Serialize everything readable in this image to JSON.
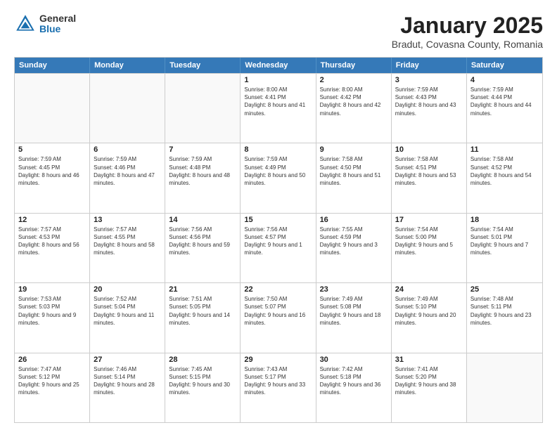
{
  "header": {
    "logo_general": "General",
    "logo_blue": "Blue",
    "main_title": "January 2025",
    "subtitle": "Bradut, Covasna County, Romania"
  },
  "days_of_week": [
    "Sunday",
    "Monday",
    "Tuesday",
    "Wednesday",
    "Thursday",
    "Friday",
    "Saturday"
  ],
  "weeks": [
    [
      {
        "day": "",
        "info": ""
      },
      {
        "day": "",
        "info": ""
      },
      {
        "day": "",
        "info": ""
      },
      {
        "day": "1",
        "info": "Sunrise: 8:00 AM\nSunset: 4:41 PM\nDaylight: 8 hours and 41 minutes."
      },
      {
        "day": "2",
        "info": "Sunrise: 8:00 AM\nSunset: 4:42 PM\nDaylight: 8 hours and 42 minutes."
      },
      {
        "day": "3",
        "info": "Sunrise: 7:59 AM\nSunset: 4:43 PM\nDaylight: 8 hours and 43 minutes."
      },
      {
        "day": "4",
        "info": "Sunrise: 7:59 AM\nSunset: 4:44 PM\nDaylight: 8 hours and 44 minutes."
      }
    ],
    [
      {
        "day": "5",
        "info": "Sunrise: 7:59 AM\nSunset: 4:45 PM\nDaylight: 8 hours and 46 minutes."
      },
      {
        "day": "6",
        "info": "Sunrise: 7:59 AM\nSunset: 4:46 PM\nDaylight: 8 hours and 47 minutes."
      },
      {
        "day": "7",
        "info": "Sunrise: 7:59 AM\nSunset: 4:48 PM\nDaylight: 8 hours and 48 minutes."
      },
      {
        "day": "8",
        "info": "Sunrise: 7:59 AM\nSunset: 4:49 PM\nDaylight: 8 hours and 50 minutes."
      },
      {
        "day": "9",
        "info": "Sunrise: 7:58 AM\nSunset: 4:50 PM\nDaylight: 8 hours and 51 minutes."
      },
      {
        "day": "10",
        "info": "Sunrise: 7:58 AM\nSunset: 4:51 PM\nDaylight: 8 hours and 53 minutes."
      },
      {
        "day": "11",
        "info": "Sunrise: 7:58 AM\nSunset: 4:52 PM\nDaylight: 8 hours and 54 minutes."
      }
    ],
    [
      {
        "day": "12",
        "info": "Sunrise: 7:57 AM\nSunset: 4:53 PM\nDaylight: 8 hours and 56 minutes."
      },
      {
        "day": "13",
        "info": "Sunrise: 7:57 AM\nSunset: 4:55 PM\nDaylight: 8 hours and 58 minutes."
      },
      {
        "day": "14",
        "info": "Sunrise: 7:56 AM\nSunset: 4:56 PM\nDaylight: 8 hours and 59 minutes."
      },
      {
        "day": "15",
        "info": "Sunrise: 7:56 AM\nSunset: 4:57 PM\nDaylight: 9 hours and 1 minute."
      },
      {
        "day": "16",
        "info": "Sunrise: 7:55 AM\nSunset: 4:59 PM\nDaylight: 9 hours and 3 minutes."
      },
      {
        "day": "17",
        "info": "Sunrise: 7:54 AM\nSunset: 5:00 PM\nDaylight: 9 hours and 5 minutes."
      },
      {
        "day": "18",
        "info": "Sunrise: 7:54 AM\nSunset: 5:01 PM\nDaylight: 9 hours and 7 minutes."
      }
    ],
    [
      {
        "day": "19",
        "info": "Sunrise: 7:53 AM\nSunset: 5:03 PM\nDaylight: 9 hours and 9 minutes."
      },
      {
        "day": "20",
        "info": "Sunrise: 7:52 AM\nSunset: 5:04 PM\nDaylight: 9 hours and 11 minutes."
      },
      {
        "day": "21",
        "info": "Sunrise: 7:51 AM\nSunset: 5:05 PM\nDaylight: 9 hours and 14 minutes."
      },
      {
        "day": "22",
        "info": "Sunrise: 7:50 AM\nSunset: 5:07 PM\nDaylight: 9 hours and 16 minutes."
      },
      {
        "day": "23",
        "info": "Sunrise: 7:49 AM\nSunset: 5:08 PM\nDaylight: 9 hours and 18 minutes."
      },
      {
        "day": "24",
        "info": "Sunrise: 7:49 AM\nSunset: 5:10 PM\nDaylight: 9 hours and 20 minutes."
      },
      {
        "day": "25",
        "info": "Sunrise: 7:48 AM\nSunset: 5:11 PM\nDaylight: 9 hours and 23 minutes."
      }
    ],
    [
      {
        "day": "26",
        "info": "Sunrise: 7:47 AM\nSunset: 5:12 PM\nDaylight: 9 hours and 25 minutes."
      },
      {
        "day": "27",
        "info": "Sunrise: 7:46 AM\nSunset: 5:14 PM\nDaylight: 9 hours and 28 minutes."
      },
      {
        "day": "28",
        "info": "Sunrise: 7:45 AM\nSunset: 5:15 PM\nDaylight: 9 hours and 30 minutes."
      },
      {
        "day": "29",
        "info": "Sunrise: 7:43 AM\nSunset: 5:17 PM\nDaylight: 9 hours and 33 minutes."
      },
      {
        "day": "30",
        "info": "Sunrise: 7:42 AM\nSunset: 5:18 PM\nDaylight: 9 hours and 36 minutes."
      },
      {
        "day": "31",
        "info": "Sunrise: 7:41 AM\nSunset: 5:20 PM\nDaylight: 9 hours and 38 minutes."
      },
      {
        "day": "",
        "info": ""
      }
    ]
  ]
}
